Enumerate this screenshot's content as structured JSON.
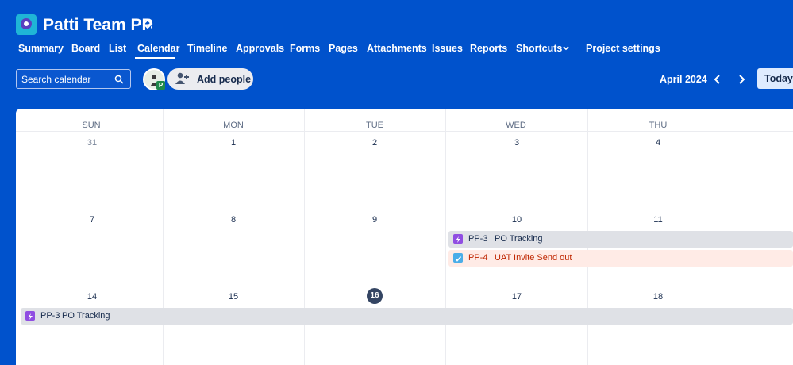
{
  "project": {
    "title": "Patti Team PP"
  },
  "nav": {
    "items": [
      "Summary",
      "Board",
      "List",
      "Calendar",
      "Timeline",
      "Approvals",
      "Forms",
      "Pages",
      "Attachments",
      "Issues",
      "Reports",
      "Shortcuts",
      "Project settings"
    ],
    "active": "Calendar"
  },
  "toolbar": {
    "search_placeholder": "Search calendar",
    "avatar_badge": "P",
    "add_people": "Add people",
    "month": "April 2024",
    "today": "Today"
  },
  "calendar": {
    "weekdays": [
      "SUN",
      "MON",
      "TUE",
      "WED",
      "THU"
    ],
    "weeks": [
      [
        "31",
        "1",
        "2",
        "3",
        "4"
      ],
      [
        "7",
        "8",
        "9",
        "10",
        "11"
      ],
      [
        "14",
        "15",
        "16",
        "17",
        "18"
      ]
    ],
    "today": "16",
    "events": [
      {
        "key": "PP-3",
        "title": "PO Tracking",
        "type": "epic",
        "status": "grey"
      },
      {
        "key": "PP-4",
        "title": "UAT Invite Send out",
        "type": "task",
        "status": "red"
      },
      {
        "key": "PP-3",
        "title": "PO Tracking",
        "type": "epic",
        "status": "grey"
      }
    ]
  },
  "colors": {
    "brand": "#0052cc",
    "epic": "#904ee2",
    "task": "#4bade8",
    "overdue_text": "#bf2600"
  }
}
